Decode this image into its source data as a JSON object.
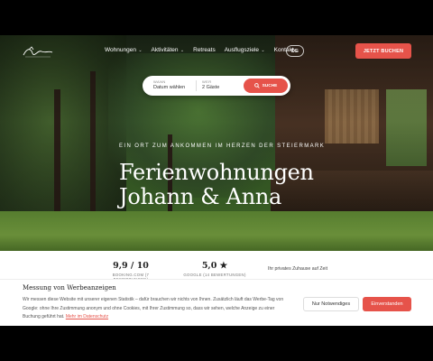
{
  "nav": {
    "items": [
      {
        "label": "Wohnungen",
        "dropdown": true
      },
      {
        "label": "Aktivitäten",
        "dropdown": true
      },
      {
        "label": "Retreats",
        "dropdown": false
      },
      {
        "label": "Ausflugsziele",
        "dropdown": true
      },
      {
        "label": "Kontakt",
        "dropdown": true
      }
    ],
    "language": "DE",
    "book_label": "JETZT BUCHEN",
    "accent": "#e6534a"
  },
  "search": {
    "when_label": "WANN",
    "when_value": "Datum wählen",
    "who_label": "WER",
    "who_value": "2 Gäste",
    "button_label": "SUCHE"
  },
  "hero": {
    "tagline": "EIN ORT ZUM ANKOMMEN IM HERZEN DER STEIERMARK",
    "title_line1": "Ferienwohnungen",
    "title_line2": "Johann & Anna"
  },
  "ratings": {
    "items": [
      {
        "score": "9,9 / 10",
        "source": "BOOKING.COM (7 BEWERTUNGEN)"
      },
      {
        "score": "5,0 ★",
        "source": "GOOGLE (14 BEWERTUNGEN)"
      }
    ],
    "note": "Ihr privates Zuhause auf Zeit"
  },
  "cookie": {
    "title": "Messung von Werbeanzeigen",
    "text": "Wir messen diese Website mit unserer eigenen Statistik – dafür brauchen wir nichts von Ihnen. Zusätzlich läuft das Werbe-Tag von Google: ohne Ihre Zustimmung anonym und ohne Cookies, mit Ihrer Zustimmung so, dass wir sehen, welche Anzeige zu einer Buchung geführt hat.",
    "link_label": "Mehr im Datenschutz",
    "necessary_label": "Nur Notwendiges",
    "accept_label": "Einverstanden"
  }
}
